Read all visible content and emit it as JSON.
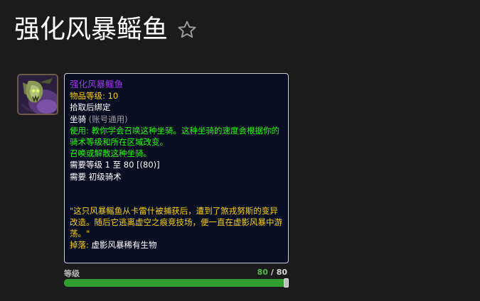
{
  "page": {
    "title": "强化风暴鳐鱼",
    "favorite_icon": "star-outline-icon"
  },
  "item_icon": "storm-ray-mount-icon",
  "tooltip": {
    "name": "强化风暴鳐鱼",
    "item_level_label": "物品等级:",
    "item_level_value": "10",
    "binding": "拾取后绑定",
    "type": "坐骑",
    "type_note": "(账号通用)",
    "use_text": "使用: 教你学会召唤这种坐骑。这种坐骑的速度会根据你的骑术等级和所在区域改变。",
    "use_line2": "召唤或解散这种坐骑。",
    "req_level_label": "需要等级",
    "req_level_value": "1 至 80 [(80)]",
    "req_skill_label": "需要",
    "req_skill_value": "初级骑术",
    "flavor": "\"这只风暴鳐鱼从卡雷什被捕获后，遭到了煞戎努斯的变异改造。随后它逃离虚空之痕竞技场，便一直在虚影风暴中游荡。\"",
    "drop_label": "掉落:",
    "drop_value": "虚影风暴稀有生物"
  },
  "level_slider": {
    "label": "等级",
    "current": "80",
    "separator": "/",
    "max": "80",
    "fraction": 1.0,
    "fill_color": "#2f9f2f"
  },
  "colors": {
    "epic": "#a335ee",
    "gold": "#ffd100",
    "green": "#1eff00",
    "gray": "#9d9d9d"
  }
}
